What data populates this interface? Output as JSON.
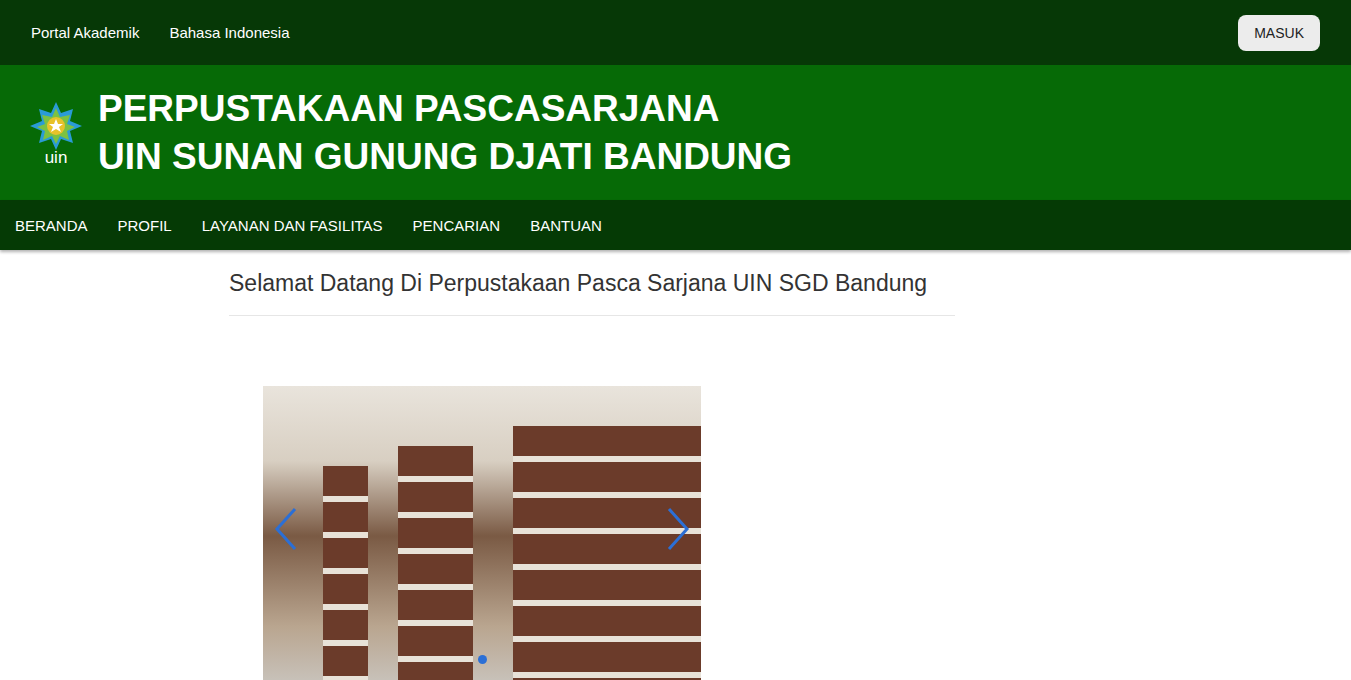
{
  "top_bar": {
    "links": [
      "Portal Akademik",
      "Bahasa Indonesia"
    ],
    "login_button": "MASUK"
  },
  "header": {
    "logo_text": "uin",
    "title_lines": [
      "PERPUSTAKAAN PASCASARJANA",
      "UIN SUNAN GUNUNG DJATI BANDUNG"
    ]
  },
  "nav": {
    "items": [
      {
        "label": "BERANDA",
        "selected": false
      },
      {
        "label": "PROFIL",
        "selected": false
      },
      {
        "label": "LAYANAN DAN FASILITAS",
        "selected": false
      },
      {
        "label": "PENCARIAN",
        "selected": false
      },
      {
        "label": "BANTUAN",
        "selected": false
      }
    ]
  },
  "main": {
    "heading": "Selamat Datang Di Perpustakaan Pasca Sarjana UIN SGD Bandung"
  },
  "carousel": {
    "indicators": [
      {
        "selected": true
      }
    ]
  }
}
